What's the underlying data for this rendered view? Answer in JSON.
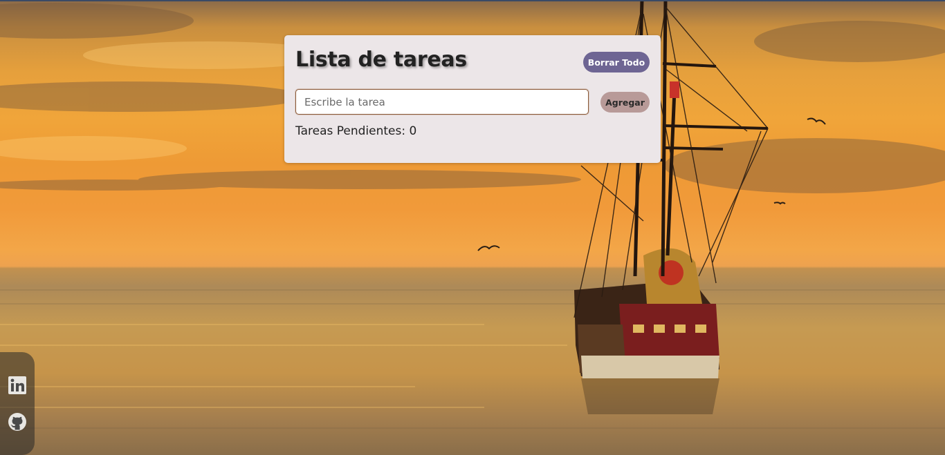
{
  "card": {
    "title": "Lista de tareas",
    "clear_all_label": "Borrar Todo",
    "input": {
      "placeholder": "Escribe la tarea",
      "value": ""
    },
    "add_label": "Agregar",
    "pending_label": "Tareas Pendientes: 0"
  },
  "social": {
    "links": [
      {
        "icon": "linkedin-icon"
      },
      {
        "icon": "github-icon"
      }
    ]
  },
  "colors": {
    "card_background": "#ece6e8",
    "clear_button": "#6e6593",
    "add_button": "#b89a98"
  }
}
